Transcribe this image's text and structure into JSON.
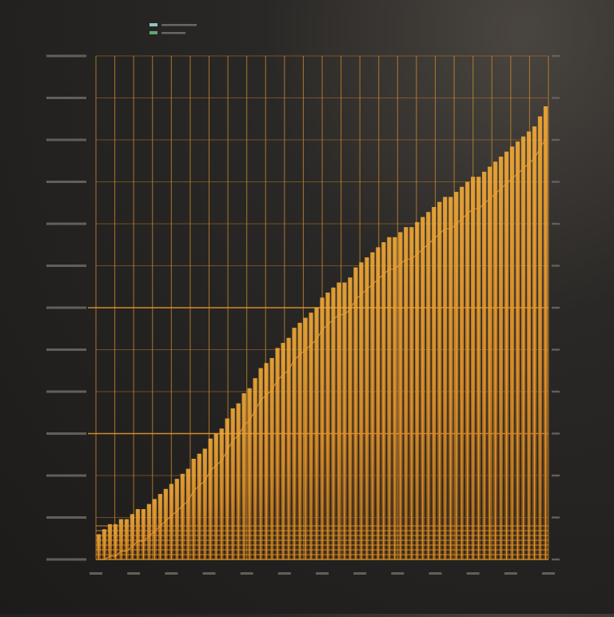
{
  "chart_data": {
    "type": "bar",
    "title": "",
    "subtitle": "",
    "xlabel": "",
    "ylabel": "",
    "grid": true,
    "legend_placement": "top-left",
    "ylim": [
      0,
      100
    ],
    "colors": {
      "background": "#222120",
      "bar": "#f0a030",
      "bar_dark": "#b86f18",
      "grid": "#c8872e",
      "baseline": "#e0952a",
      "legend_green": "#5fa870",
      "text": "#8a8580"
    },
    "legend": [
      {
        "name": "",
        "color": "#8ec4c0"
      },
      {
        "name": "",
        "color": "#5fa870"
      }
    ],
    "series": [
      {
        "name": "",
        "values": [
          5,
          6,
          7,
          7,
          8,
          8,
          9,
          10,
          10,
          11,
          12,
          13,
          14,
          15,
          16,
          17,
          18,
          20,
          21,
          22,
          24,
          25,
          26,
          28,
          30,
          31,
          33,
          34,
          36,
          38,
          39,
          40,
          42,
          43,
          44,
          46,
          47,
          48,
          49,
          50,
          52,
          53,
          54,
          55,
          55,
          56,
          58,
          59,
          60,
          61,
          62,
          63,
          64,
          64,
          65,
          66,
          66,
          67,
          68,
          69,
          70,
          71,
          72,
          72,
          73,
          74,
          75,
          76,
          76,
          77,
          78,
          79,
          80,
          81,
          82,
          83,
          84,
          85,
          86,
          88,
          90
        ]
      }
    ]
  }
}
